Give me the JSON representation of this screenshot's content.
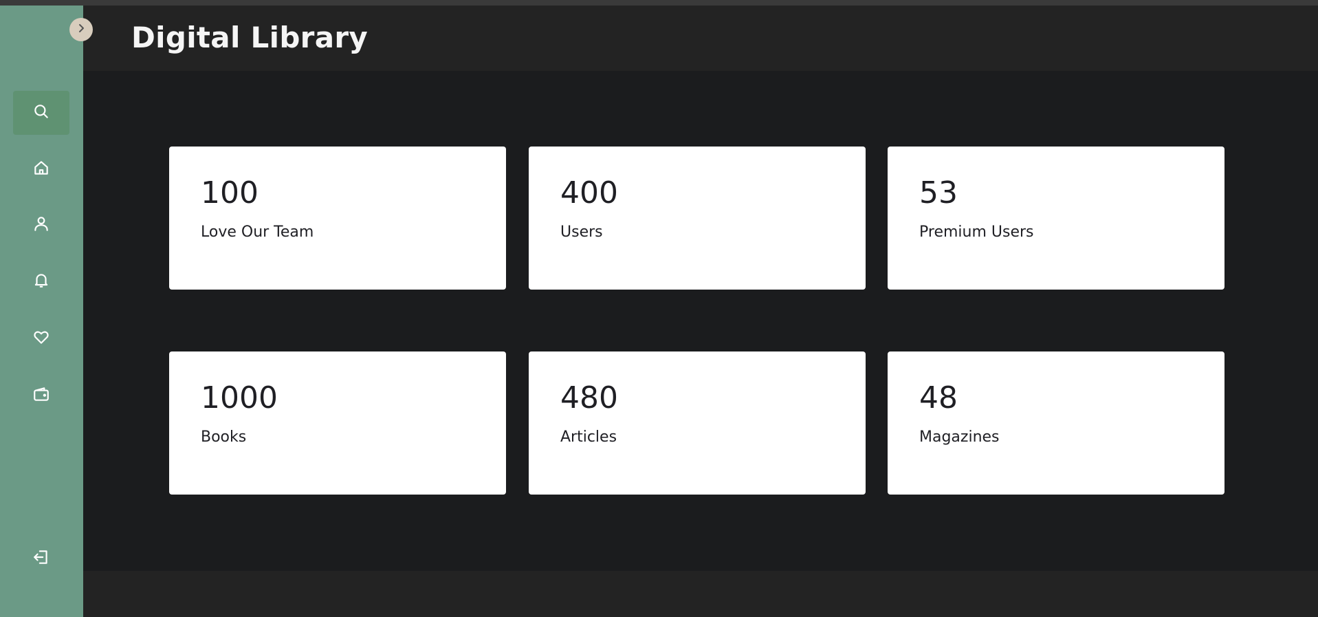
{
  "header": {
    "title": "Digital Library"
  },
  "sidebar": {
    "toggle_icon": "chevron-right-icon",
    "items": [
      {
        "icon": "search-icon",
        "active": true
      },
      {
        "icon": "home-icon",
        "active": false
      },
      {
        "icon": "user-icon",
        "active": false
      },
      {
        "icon": "bell-icon",
        "active": false
      },
      {
        "icon": "heart-icon",
        "active": false
      },
      {
        "icon": "wallet-icon",
        "active": false
      }
    ],
    "logout_icon": "logout-icon"
  },
  "stats": [
    {
      "value": "100",
      "label": "Love Our Team"
    },
    {
      "value": "400",
      "label": "Users"
    },
    {
      "value": "53",
      "label": "Premium Users"
    },
    {
      "value": "1000",
      "label": "Books"
    },
    {
      "value": "480",
      "label": "Articles"
    },
    {
      "value": "48",
      "label": "Magazines"
    }
  ],
  "colors": {
    "sidebar": "#6b9a86",
    "sidebar_active": "#5f9272",
    "toggle": "#d8cdbd",
    "header_bg": "#232323",
    "main_bg": "#1b1c1e",
    "card_bg": "#ffffff",
    "card_text": "#1f1f24"
  }
}
